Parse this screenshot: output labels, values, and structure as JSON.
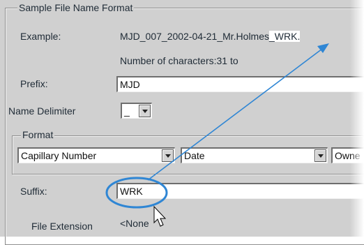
{
  "group": {
    "title": "Sample File Name Format"
  },
  "example": {
    "label": "Example:",
    "value_main": "MJD_007_2002-04-21_Mr.Holmes",
    "value_suffix": "_WRK.",
    "char_count": "Number of characters:31 to"
  },
  "prefix": {
    "label": "Prefix:",
    "value": "MJD"
  },
  "delimiter": {
    "label": "Name Delimiter",
    "value": "_"
  },
  "format": {
    "title": "Format",
    "fields": [
      {
        "value": "Capillary Number"
      },
      {
        "value": "Date"
      },
      {
        "value": "Owne"
      }
    ]
  },
  "suffix": {
    "label": "Suffix:",
    "value": "WRK"
  },
  "extension": {
    "label": "File Extension",
    "value": "<None"
  },
  "annotation": {
    "color": "#2f86d4"
  }
}
